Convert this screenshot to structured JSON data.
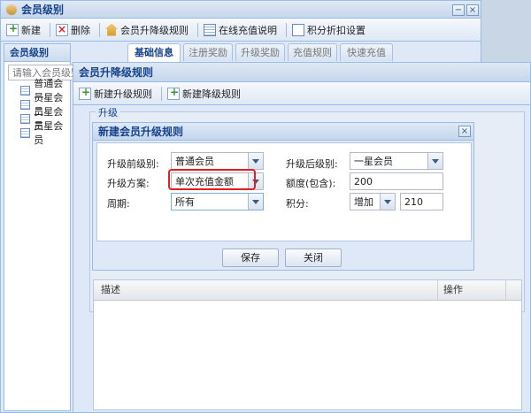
{
  "win1": {
    "title": "会员级别",
    "toolbar": [
      "新建",
      "删除",
      "会员升降级规则",
      "在线充值说明",
      "积分折扣设置"
    ],
    "left_panel": {
      "title": "会员级别",
      "search_placeholder": "请输入会员级别",
      "items": [
        "普通会员",
        "一星会员",
        "二星会员",
        "三星会员"
      ]
    },
    "tabs": [
      "基础信息",
      "注册奖励",
      "升级奖励",
      "充值规则",
      "快速充值"
    ]
  },
  "win2": {
    "title": "会员升降级规则",
    "toolbar": [
      "新建升级规则",
      "新建降级规则"
    ],
    "section_label": "升级",
    "grid_headers": [
      "描述",
      "操作"
    ]
  },
  "dialog": {
    "title": "新建会员升级规则",
    "labels": {
      "from": "升级前级别:",
      "to": "升级后级别:",
      "scheme": "升级方案:",
      "quota": "额度(包含):",
      "period": "周期:",
      "points": "积分:"
    },
    "values": {
      "from": "普通会员",
      "to": "一星会员",
      "scheme": "单次充值金额",
      "quota": "200",
      "period": "所有",
      "points_op": "增加",
      "points": "210"
    },
    "buttons": {
      "save": "保存",
      "close": "关闭"
    }
  },
  "colors": {
    "highlight": "#e02020",
    "title_text": "#15428b"
  }
}
